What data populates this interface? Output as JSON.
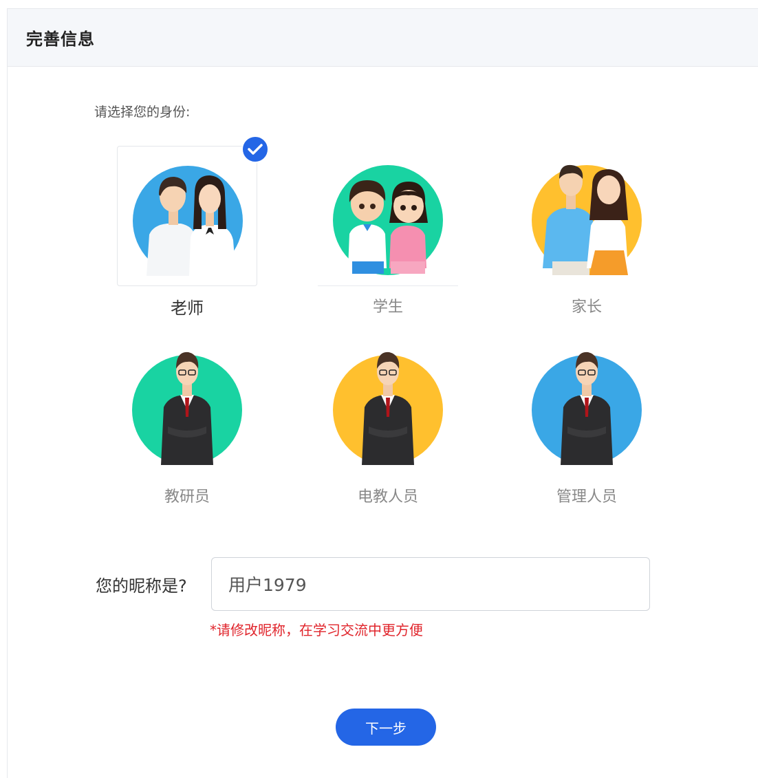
{
  "header": {
    "title": "完善信息"
  },
  "prompt": "请选择您的身份:",
  "roles": [
    {
      "label": "老师",
      "selected": true,
      "bg": "#3aa7e6"
    },
    {
      "label": "学生",
      "selected": false,
      "bg": "#19d3a2"
    },
    {
      "label": "家长",
      "selected": false,
      "bg": "#ffc02e"
    },
    {
      "label": "教研员",
      "selected": false,
      "bg": "#19d3a2"
    },
    {
      "label": "电教人员",
      "selected": false,
      "bg": "#ffc02e"
    },
    {
      "label": "管理人员",
      "selected": false,
      "bg": "#3aa7e6"
    }
  ],
  "nickname": {
    "label": "您的昵称是?",
    "value": "用户1979",
    "hint": "*请修改昵称，在学习交流中更方便"
  },
  "next_button": "下一步",
  "colors": {
    "accent": "#2466e6",
    "hint": "#e0242b"
  },
  "icons": {
    "selected_check": "check-circle-icon"
  }
}
